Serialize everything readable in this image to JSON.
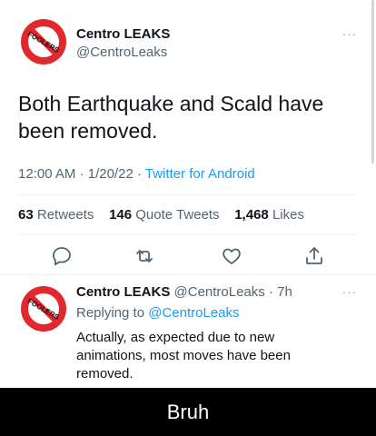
{
  "tweet": {
    "display_name": "Centro LEAKS",
    "handle": "@CentroLeaks",
    "text_line1": "Both Earthquake and Scald have",
    "text_line2": "been removed.",
    "time": "12:00 AM",
    "date": "1/20/22",
    "source": "Twitter for Android",
    "more": "···",
    "avatar_text": "FOOLERS"
  },
  "stats": {
    "retweets_count": "63",
    "retweets_label": "Retweets",
    "quotes_count": "146",
    "quotes_label": "Quote Tweets",
    "likes_count": "1,468",
    "likes_label": "Likes"
  },
  "actions": [
    "reply-icon",
    "retweet-icon",
    "like-icon",
    "share-icon"
  ],
  "reply": {
    "display_name": "Centro LEAKS",
    "handle": "@CentroLeaks",
    "time_ago": "7h",
    "replying_prefix": "Replying to",
    "replying_mention": "@CentroLeaks",
    "text_line1": "Actually, as expected due to new",
    "text_line2": "animations, most moves have been",
    "text_line3": "removed.",
    "more": "···",
    "avatar_text": "FOOLERS"
  },
  "caption": "Bruh",
  "colors": {
    "accent": "#1d9bf0",
    "avatar_red": "#e0282e",
    "text": "#0f1419",
    "muted": "#536471"
  }
}
